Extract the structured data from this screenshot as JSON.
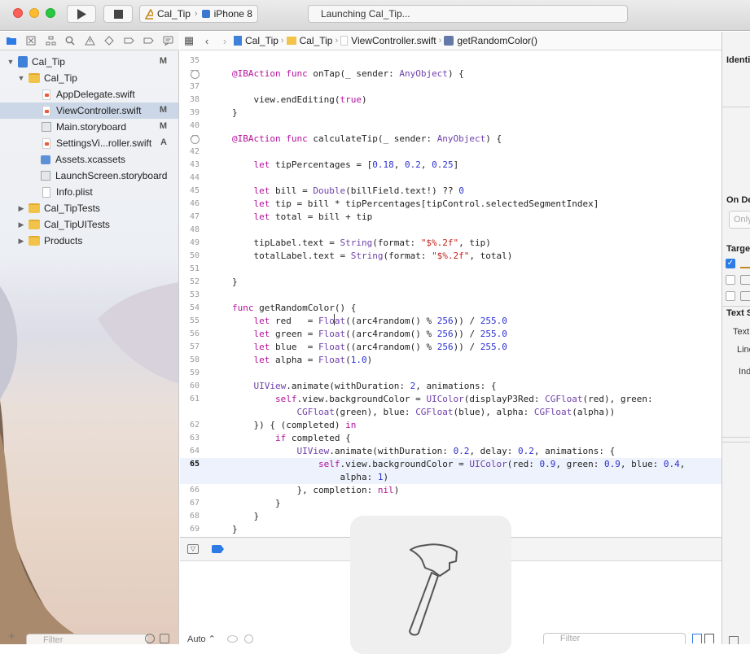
{
  "toolbar": {
    "scheme_name": "Cal_Tip",
    "device": "iPhone 8",
    "status": "Launching Cal_Tip..."
  },
  "navigator": {
    "items": [
      {
        "label": "Cal_Tip",
        "badge": "M"
      },
      {
        "label": "Cal_Tip",
        "badge": ""
      },
      {
        "label": "AppDelegate.swift",
        "badge": ""
      },
      {
        "label": "ViewController.swift",
        "badge": "M"
      },
      {
        "label": "Main.storyboard",
        "badge": "M"
      },
      {
        "label": "SettingsVi...roller.swift",
        "badge": "A"
      },
      {
        "label": "Assets.xcassets",
        "badge": ""
      },
      {
        "label": "LaunchScreen.storyboard",
        "badge": ""
      },
      {
        "label": "Info.plist",
        "badge": ""
      },
      {
        "label": "Cal_TipTests",
        "badge": ""
      },
      {
        "label": "Cal_TipUITests",
        "badge": ""
      },
      {
        "label": "Products",
        "badge": ""
      }
    ],
    "filter_placeholder": "Filter"
  },
  "jumpbar": [
    "Cal_Tip",
    "Cal_Tip",
    "ViewController.swift",
    "getRandomColor()"
  ],
  "code_lines": [
    {
      "n": "35",
      "code": ""
    },
    {
      "n": "36",
      "code": "    @IBAction func onTap(_ sender: AnyObject) {"
    },
    {
      "n": "37",
      "code": ""
    },
    {
      "n": "38",
      "code": "        view.endEditing(true)"
    },
    {
      "n": "39",
      "code": "    }"
    },
    {
      "n": "40",
      "code": ""
    },
    {
      "n": "41",
      "code": "    @IBAction func calculateTip(_ sender: AnyObject) {"
    },
    {
      "n": "42",
      "code": ""
    },
    {
      "n": "43",
      "code": "        let tipPercentages = [0.18, 0.2, 0.25]"
    },
    {
      "n": "44",
      "code": ""
    },
    {
      "n": "45",
      "code": "        let bill = Double(billField.text!) ?? 0"
    },
    {
      "n": "46",
      "code": "        let tip = bill * tipPercentages[tipControl.selectedSegmentIndex]"
    },
    {
      "n": "47",
      "code": "        let total = bill + tip"
    },
    {
      "n": "48",
      "code": ""
    },
    {
      "n": "49",
      "code": "        tipLabel.text = String(format: \"$%.2f\", tip)"
    },
    {
      "n": "50",
      "code": "        totalLabel.text = String(format: \"$%.2f\", total)"
    },
    {
      "n": "51",
      "code": ""
    },
    {
      "n": "52",
      "code": "    }"
    },
    {
      "n": "53",
      "code": ""
    },
    {
      "n": "54",
      "code": "    func getRandomColor() {"
    },
    {
      "n": "55",
      "code": "        let red   = Float((arc4random() % 256)) / 255.0"
    },
    {
      "n": "56",
      "code": "        let green = Float((arc4random() % 256)) / 255.0"
    },
    {
      "n": "57",
      "code": "        let blue  = Float((arc4random() % 256)) / 255.0"
    },
    {
      "n": "58",
      "code": "        let alpha = Float(1.0)"
    },
    {
      "n": "59",
      "code": ""
    },
    {
      "n": "60",
      "code": "        UIView.animate(withDuration: 2, animations: {"
    },
    {
      "n": "61",
      "code": "            self.view.backgroundColor = UIColor(displayP3Red: CGFloat(red), green:"
    },
    {
      "n": "",
      "code": "                CGFloat(green), blue: CGFloat(blue), alpha: CGFloat(alpha))"
    },
    {
      "n": "62",
      "code": "        }) { (completed) in"
    },
    {
      "n": "63",
      "code": "            if completed {"
    },
    {
      "n": "64",
      "code": "                UIView.animate(withDuration: 0.2, delay: 0.2, animations: {"
    },
    {
      "n": "65",
      "code": "                    self.view.backgroundColor = UIColor(red: 0.9, green: 0.9, blue: 0.4,"
    },
    {
      "n": "",
      "code": "                        alpha: 1)"
    },
    {
      "n": "66",
      "code": "                }, completion: nil)"
    },
    {
      "n": "67",
      "code": "            }"
    },
    {
      "n": "68",
      "code": "        }"
    },
    {
      "n": "69",
      "code": "    }"
    }
  ],
  "debug": {
    "auto_label": "Auto ⌃",
    "filter_placeholder": "Filter"
  },
  "inspector": {
    "identity": "Identi",
    "on_demand": "On De",
    "only": "Only",
    "target": "Targe",
    "text_settings": "Text S",
    "text": "Text",
    "line": "Line",
    "indent": "Ind"
  },
  "colors": {
    "keyword": "#b5119b",
    "type": "#6f41a9",
    "string": "#c3221a",
    "number": "#2b30d0",
    "selection": "#cbd7e7",
    "current_line": "#edf2fc"
  }
}
